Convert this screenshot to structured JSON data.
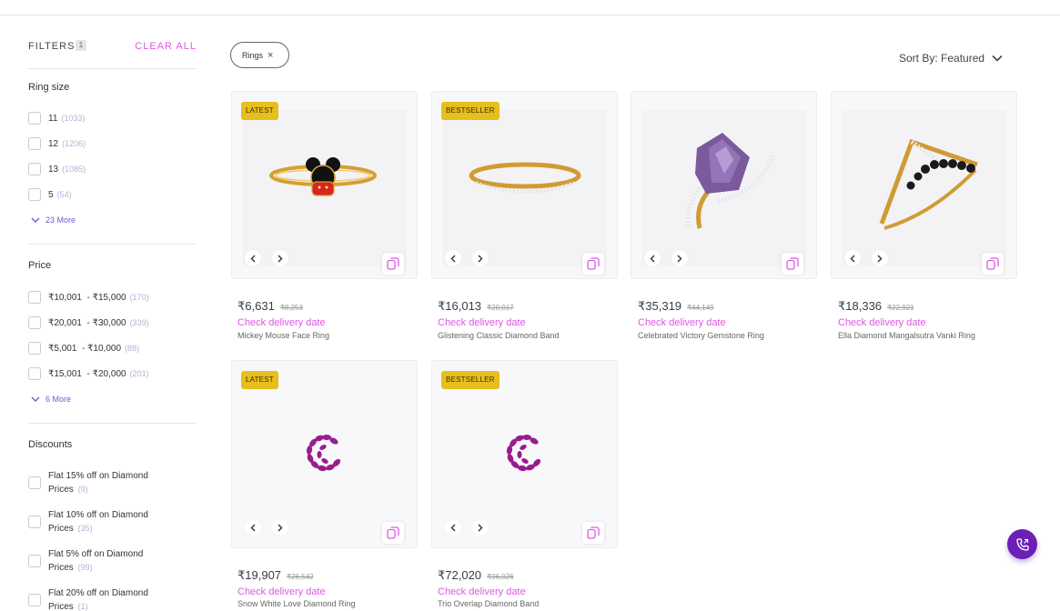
{
  "filters": {
    "title": "FILTERS",
    "count": "1",
    "clear_all": "CLEAR ALL",
    "ring_size": {
      "title": "Ring size",
      "options": [
        {
          "label": "11",
          "count": "(1033)"
        },
        {
          "label": "12",
          "count": "(1206)"
        },
        {
          "label": "13",
          "count": "(1085)"
        },
        {
          "label": "5",
          "count": "(54)"
        }
      ],
      "more": "23 More"
    },
    "price": {
      "title": "Price",
      "options": [
        {
          "label": "₹10,001  - ₹15,000",
          "count": "(170)"
        },
        {
          "label": "₹20,001  - ₹30,000",
          "count": "(339)"
        },
        {
          "label": "₹5,001  - ₹10,000",
          "count": "(88)"
        },
        {
          "label": "₹15,001  - ₹20,000",
          "count": "(201)"
        }
      ],
      "more": "6 More"
    },
    "discounts": {
      "title": "Discounts",
      "options": [
        {
          "label_line1": "Flat 15% off on Diamond",
          "label_line2": "Prices",
          "count": "(9)"
        },
        {
          "label_line1": "Flat 10% off on Diamond",
          "label_line2": "Prices",
          "count": "(35)"
        },
        {
          "label_line1": "Flat 5% off on Diamond",
          "label_line2": "Prices",
          "count": "(99)"
        },
        {
          "label_line1": "Flat 20% off on Diamond",
          "label_line2": "Prices",
          "count": "(1)"
        }
      ]
    }
  },
  "applied_chip": {
    "label": "Rings",
    "remove": "×"
  },
  "sort": {
    "label": "Sort By: Featured"
  },
  "products": [
    {
      "badge": "LATEST",
      "price": "₹6,631",
      "mrp": "₹8,253",
      "delivery": "Check delivery date",
      "name": "Mickey Mouse Face Ring"
    },
    {
      "badge": "BESTSELLER",
      "price": "₹16,013",
      "mrp": "₹20,017",
      "delivery": "Check delivery date",
      "name": "Glistening Classic Diamond Band"
    },
    {
      "badge": "",
      "price": "₹35,319",
      "mrp": "₹44,149",
      "delivery": "Check delivery date",
      "name": "Celebrated Victory Gemstone Ring"
    },
    {
      "badge": "",
      "price": "₹18,336",
      "mrp": "₹22,921",
      "delivery": "Check delivery date",
      "name": "Ella Diamond Mangalsutra Vanki Ring"
    },
    {
      "badge": "LATEST",
      "price": "₹19,907",
      "mrp": "₹26,542",
      "delivery": "Check delivery date",
      "name": "Snow White Love Diamond Ring"
    },
    {
      "badge": "BESTSELLER",
      "price": "₹72,020",
      "mrp": "₹96,026",
      "delivery": "Check delivery date",
      "name": "Trio Overlap Diamond Band"
    }
  ],
  "colors": {
    "accent": "#de57e5",
    "badge": "#e6be1d",
    "fab": "#6b1fb5",
    "more_link": "#6f5bd6"
  },
  "icons": {
    "prev": "chevron-left-icon",
    "next": "chevron-right-icon",
    "compare": "compare-icon",
    "sort": "chevron-down-icon",
    "fab": "phone-call-icon"
  }
}
